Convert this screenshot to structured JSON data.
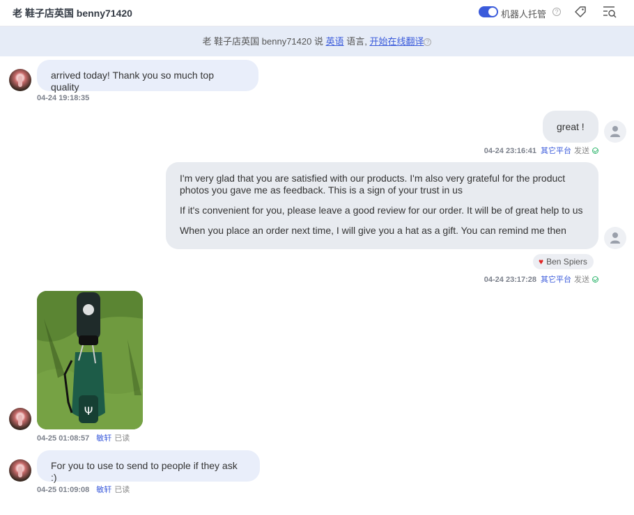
{
  "header": {
    "title": "老 鞋子店英国 benny71420",
    "robot_label": "机器人托管",
    "robot_enabled": true,
    "help": "?"
  },
  "notice": {
    "prefix": "老 鞋子店英国 benny71420 说 ",
    "language_link": "英语",
    "middle": " 语言, ",
    "translate_link": "开始在线翻译",
    "help": "?"
  },
  "messages": [
    {
      "direction": "in",
      "text": "arrived today! Thank you so much top quality",
      "time": "04-24 19:18:35"
    },
    {
      "direction": "out",
      "text": "great !",
      "time": "04-24 23:16:41",
      "platform": "其它平台",
      "status": "发送"
    },
    {
      "direction": "out",
      "paragraphs": [
        "I'm very glad that you are satisfied with our products. I'm also very grateful for the product photos you gave me as feedback. This is a sign of your trust in us",
        "If it's convenient for you, please leave a good review for our order. It will be of great help to us",
        "When you place an order next time, I will give you a hat as a gift. You can remind me then"
      ],
      "reaction_name": "Ben Spiers",
      "time": "04-24 23:17:28",
      "platform": "其它平台",
      "status": "发送"
    },
    {
      "direction": "in",
      "type": "image",
      "time": "04-25 01:08:57",
      "platform": "敏轩",
      "status": "已读"
    },
    {
      "direction": "in",
      "text": "For you to use to send to people if they ask :)",
      "time": "04-25 01:09:08",
      "platform": "敏轩",
      "status": "已读"
    }
  ],
  "colors": {
    "accent": "#3b5bdb",
    "incoming_bubble": "#e9eefa",
    "outgoing_bubble": "#e8ebf0",
    "notice_bg": "#e6ecf7",
    "check": "#2fb56d"
  }
}
